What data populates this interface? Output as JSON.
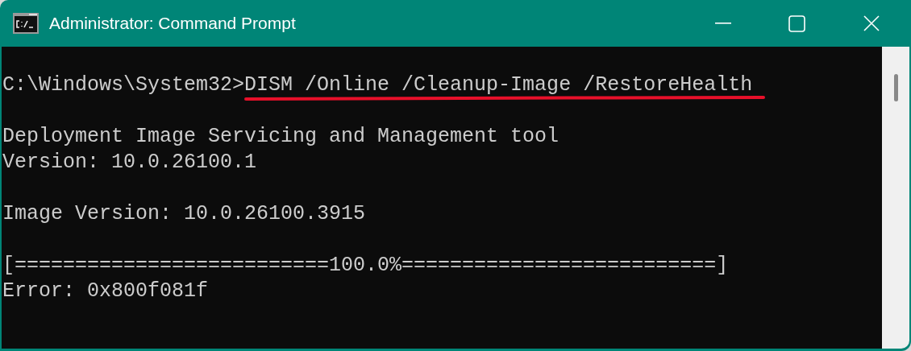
{
  "window": {
    "title": "Administrator: Command Prompt"
  },
  "console": {
    "prompt": "C:\\Windows\\System32>",
    "command": "DISM /Online /Cleanup-Image /RestoreHealth",
    "command_underlined": true,
    "output_blocks": [
      [
        "Deployment Image Servicing and Management tool",
        "Version: 10.0.26100.1"
      ],
      [
        "Image Version: 10.0.26100.3915"
      ],
      [
        "[==========================100.0%==========================]",
        "Error: 0x800f081f"
      ]
    ]
  }
}
